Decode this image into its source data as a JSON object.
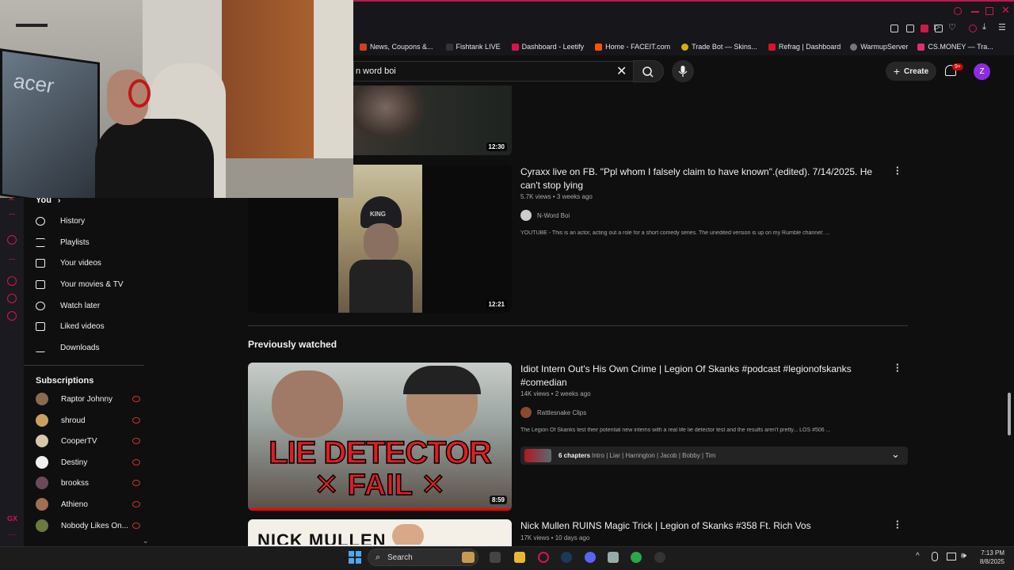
{
  "browser": {
    "bookmarks": [
      {
        "label": "News, Coupons &...",
        "color": "#d04020"
      },
      {
        "label": "Fishtank LIVE",
        "color": "#333333"
      },
      {
        "label": "Dashboard - Leetify",
        "color": "#e01050"
      },
      {
        "label": "Home - FACEIT.com",
        "color": "#ff5500"
      },
      {
        "label": "Trade Bot — Skins...",
        "color": "#d8b000"
      },
      {
        "label": "Refrag | Dashboard",
        "color": "#e0102a"
      },
      {
        "label": "WarmupServer",
        "color": "#777777"
      },
      {
        "label": "CS.MONEY — Tra...",
        "color": "#e0306a"
      }
    ]
  },
  "header": {
    "search_value": "n word boi",
    "create_label": "Create",
    "notification_badge": "9+",
    "avatar_letter": "Z"
  },
  "sidebar": {
    "you_title": "You",
    "you_items": [
      {
        "label": "History",
        "icon": "history-icon"
      },
      {
        "label": "Playlists",
        "icon": "playlists-icon"
      },
      {
        "label": "Your videos",
        "icon": "your-videos-icon"
      },
      {
        "label": "Your movies & TV",
        "icon": "movies-icon"
      },
      {
        "label": "Watch later",
        "icon": "watch-later-icon"
      },
      {
        "label": "Liked videos",
        "icon": "like-icon"
      },
      {
        "label": "Downloads",
        "icon": "download-icon"
      }
    ],
    "subscriptions_title": "Subscriptions",
    "subscriptions": [
      {
        "label": "Raptor Johnny",
        "color": "#8a6a50"
      },
      {
        "label": "shroud",
        "color": "#c8a060"
      },
      {
        "label": "CooperTV",
        "color": "#d8c8a8"
      },
      {
        "label": "Destiny",
        "color": "#f0f0f0"
      },
      {
        "label": "brookss",
        "color": "#6a4a5a"
      },
      {
        "label": "Athieno",
        "color": "#a07050"
      },
      {
        "label": "Nobody Likes On...",
        "color": "#6a7a40"
      }
    ]
  },
  "videos": [
    {
      "duration": "12:30"
    },
    {
      "title": "Cyraxx live on FB. \"Ppl whom I falsely claim to have known\".(edited). 7/14/2025. He can't stop lying",
      "meta": "5.7K views • 3 weeks ago",
      "channel": "N-Word Boi",
      "description": "YOUTUBE - This is an actor, acting out a role for a short comedy series. The unedited version is up on my Rumble channel: ...",
      "duration": "12:21",
      "beanie_text": "KING"
    }
  ],
  "previously_watched_title": "Previously watched",
  "previous_videos": [
    {
      "title": "Idiot Intern Out's His Own Crime | Legion Of Skanks #podcast #legionofskanks #comedian",
      "meta": "14K views • 2 weeks ago",
      "channel": "Rattlesnake Clips",
      "description": "The Legion Of Skanks test their potential new interns with a real life lie detector test and the results aren't pretty... LOS #506 ...",
      "duration": "8:59",
      "thumb_line1": "LIE DETECTOR",
      "thumb_line2": "✕ FAIL ✕",
      "chapters_count": "6 chapters",
      "chapters_list": "Intro | Liar | Harrington | Jacob | Bobby | Tim"
    },
    {
      "title": "Nick Mullen RUINS Magic Trick | Legion of Skanks #358 Ft. Rich Vos",
      "meta": "17K views • 10 days ago",
      "thumb_text": "NICK MULLEN"
    }
  ],
  "taskbar": {
    "search_placeholder": "Search",
    "time": "7:13 PM",
    "date": "8/8/2025"
  }
}
